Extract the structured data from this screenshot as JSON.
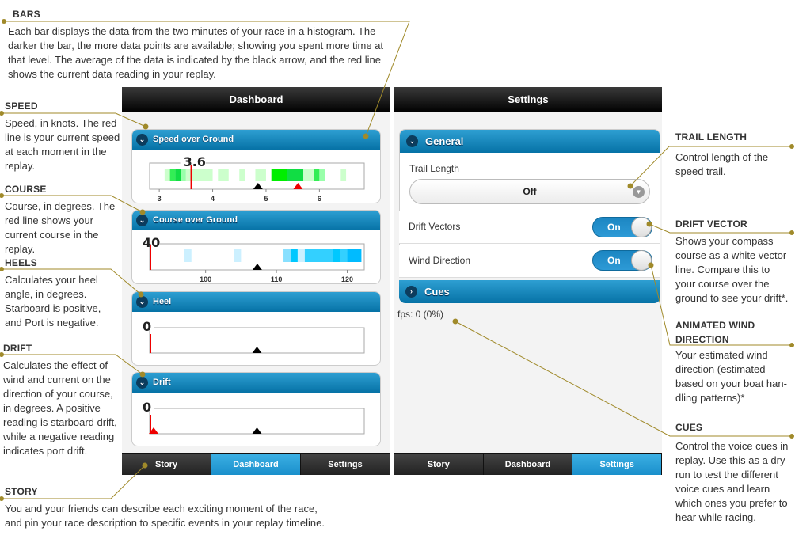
{
  "annotations": {
    "bars": {
      "title": "BARS",
      "text": "Each bar displays the data from the two minutes of your race in a histogram. The darker the bar, the more data points are available; showing you spent more time at that level.  The average of the data is indicated by the black arrow, and the red line shows the current data reading in your replay."
    },
    "speed": {
      "title": "SPEED",
      "text": "Speed, in knots.  The red line is your current speed at each moment in the replay."
    },
    "course": {
      "title": "COURSE",
      "text": "Course, in degrees.  The red line shows your current course in the replay."
    },
    "heels": {
      "title": "HEELS",
      "text": "Calculates your heel angle, in degrees. Starboard is positive, and Port is negative."
    },
    "drift": {
      "title": "DRIFT",
      "text": "Calculates the effect of wind and current on the direction of your course, in degrees. A positive reading is starboard drift, while a negative reading indicates port drift."
    },
    "story": {
      "title": "STORY",
      "text": "You and your friends can describe each exciting moment of the race, and pin your race description to specific events in your replay timeline."
    },
    "trail": {
      "title": "TRAIL LENGTH",
      "text": "Control length of the speed trail."
    },
    "driftvector": {
      "title": "DRIFT VECTOR",
      "text": "Shows your compass course as a white vector line.  Compare this to your course over the ground to see your drift*."
    },
    "wind": {
      "title": "ANIMATED WIND DIRECTION",
      "text": "Your estimated wind direction (estimated based on your boat han-dling patterns)*"
    },
    "cues": {
      "title": "CUES",
      "text": "Control the voice cues in replay.  Use this as a dry run to test the different voice cues and learn which ones you prefer to hear while racing."
    }
  },
  "accent_color": "#0672a6",
  "leader_color": "#a08a2a",
  "dashboard": {
    "title": "Dashboard",
    "panels": [
      {
        "label": "Speed over Ground",
        "value": "3.6",
        "current": 3.6,
        "average": 4.85,
        "marker": 5.6,
        "range": [
          2.82,
          6.84
        ],
        "ticks": [
          "3",
          "4",
          "5",
          "6"
        ],
        "tick_values": [
          3,
          4,
          5,
          6
        ],
        "color": "green",
        "bins": [
          [
            3.1,
            3.2,
            1
          ],
          [
            3.2,
            3.3,
            3
          ],
          [
            3.3,
            3.4,
            3.5
          ],
          [
            3.4,
            3.5,
            2
          ],
          [
            3.5,
            4.0,
            1
          ],
          [
            4.1,
            4.3,
            1
          ],
          [
            4.5,
            4.6,
            1
          ],
          [
            4.8,
            5.0,
            1
          ],
          [
            5.1,
            5.4,
            4
          ],
          [
            5.4,
            5.7,
            3.5
          ],
          [
            5.7,
            5.9,
            1
          ],
          [
            5.9,
            6.0,
            3
          ],
          [
            6.0,
            6.1,
            2
          ],
          [
            6.4,
            6.5,
            1
          ]
        ]
      },
      {
        "label": "Course over Ground",
        "value": "40",
        "current": 92.2,
        "average": 107.3,
        "range": [
          92.1,
          122.4
        ],
        "ticks": [
          "100",
          "110",
          "120"
        ],
        "tick_values": [
          100,
          110,
          120
        ],
        "color": "blue",
        "bins": [
          [
            97,
            98,
            1
          ],
          [
            104,
            105,
            1
          ],
          [
            111,
            112,
            2
          ],
          [
            112,
            113,
            4
          ],
          [
            113,
            114,
            1
          ],
          [
            114,
            118,
            3
          ],
          [
            118,
            119,
            4
          ],
          [
            119,
            120,
            3
          ],
          [
            120,
            122,
            3.5
          ]
        ]
      },
      {
        "label": "Heel",
        "value": "0",
        "current": 0,
        "average": 50,
        "range": [
          0,
          100
        ],
        "ticks": [],
        "tick_values": [],
        "color": "green",
        "bins": []
      },
      {
        "label": "Drift",
        "value": "0",
        "current": 0,
        "average": 50,
        "marker": 0.8,
        "range": [
          0,
          100
        ],
        "ticks": [],
        "tick_values": [],
        "color": "green",
        "bins": []
      }
    ],
    "tabs": [
      {
        "label": "Story"
      },
      {
        "label": "Dashboard",
        "active": true
      },
      {
        "label": "Settings"
      }
    ]
  },
  "settings": {
    "title": "Settings",
    "general_label": "General",
    "trail_length_label": "Trail Length",
    "trail_length_value": "Off",
    "drift_vectors_label": "Drift Vectors",
    "drift_vectors_value": "On",
    "wind_direction_label": "Wind Direction",
    "wind_direction_value": "On",
    "cues_label": "Cues",
    "fps": "fps: 0 (0%)",
    "tabs": [
      {
        "label": "Story"
      },
      {
        "label": "Dashboard"
      },
      {
        "label": "Settings",
        "active": true
      }
    ]
  }
}
